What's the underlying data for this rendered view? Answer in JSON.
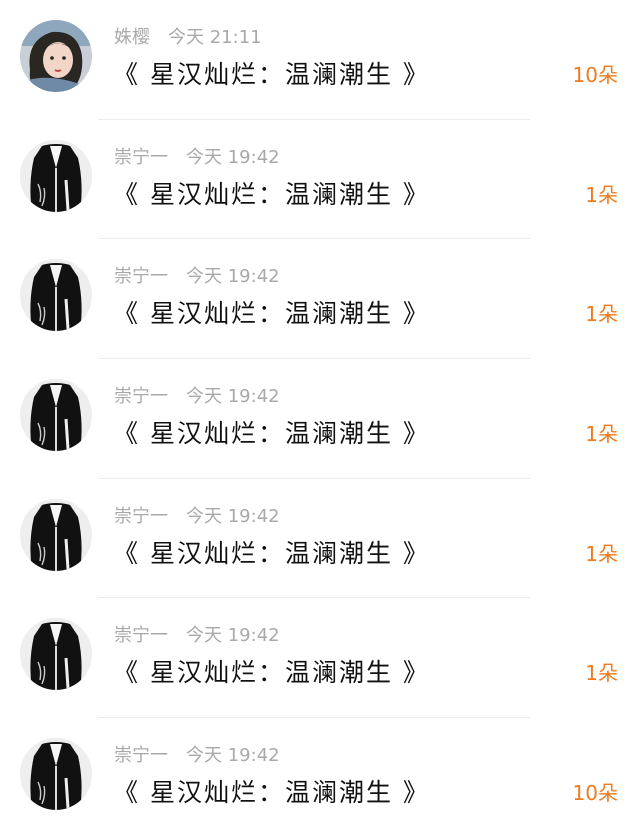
{
  "colors": {
    "accent": "#ee7b1f",
    "meta_text": "#a9a9a9",
    "title_text": "#111111",
    "divider": "#ececec"
  },
  "rows": [
    {
      "user": "姝樱",
      "time": "今天 21:11",
      "title": "《 星汉灿烂：温澜潮生 》",
      "count": "10朵",
      "avatar": "woman-portrait-avatar"
    },
    {
      "user": "崇宁一",
      "time": "今天 19:42",
      "title": "《 星汉灿烂：温澜潮生 》",
      "count": "1朵",
      "avatar": "black-robe-avatar"
    },
    {
      "user": "崇宁一",
      "time": "今天 19:42",
      "title": "《 星汉灿烂：温澜潮生 》",
      "count": "1朵",
      "avatar": "black-robe-avatar"
    },
    {
      "user": "崇宁一",
      "time": "今天 19:42",
      "title": "《 星汉灿烂：温澜潮生 》",
      "count": "1朵",
      "avatar": "black-robe-avatar"
    },
    {
      "user": "崇宁一",
      "time": "今天 19:42",
      "title": "《 星汉灿烂：温澜潮生 》",
      "count": "1朵",
      "avatar": "black-robe-avatar"
    },
    {
      "user": "崇宁一",
      "time": "今天 19:42",
      "title": "《 星汉灿烂：温澜潮生 》",
      "count": "1朵",
      "avatar": "black-robe-avatar"
    },
    {
      "user": "崇宁一",
      "time": "今天 19:42",
      "title": "《 星汉灿烂：温澜潮生 》",
      "count": "10朵",
      "avatar": "black-robe-avatar"
    }
  ]
}
